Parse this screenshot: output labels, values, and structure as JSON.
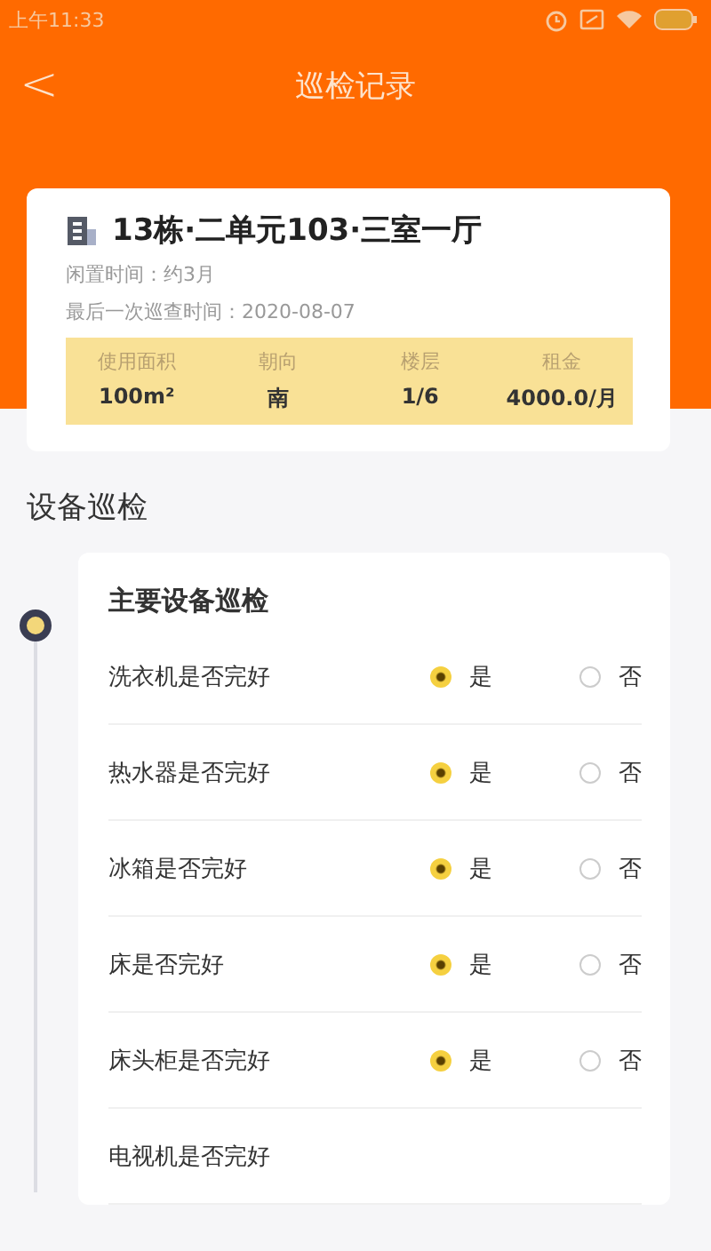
{
  "status_bar": {
    "time": "上午11:33"
  },
  "header": {
    "back": "<",
    "title": "巡检记录"
  },
  "property": {
    "title": "13栋·二单元103·三室一厅",
    "lines": [
      "闲置时间：约3月",
      "最后一次巡查时间：2020-08-07"
    ],
    "stats": [
      {
        "label": "使用面积",
        "value": "100m²"
      },
      {
        "label": "朝向",
        "value": "南"
      },
      {
        "label": "楼层",
        "value": "1/6"
      },
      {
        "label": "租金",
        "value": "4000.0/月"
      }
    ]
  },
  "section_title": "设备巡检",
  "group": {
    "title": "主要设备巡检",
    "items": [
      {
        "label": "洗衣机是否完好",
        "options": [
          {
            "label": "是",
            "selected": true
          },
          {
            "label": "否",
            "selected": false
          }
        ]
      },
      {
        "label": "热水器是否完好",
        "options": [
          {
            "label": "是",
            "selected": true
          },
          {
            "label": "否",
            "selected": false
          }
        ]
      },
      {
        "label": "冰箱是否完好",
        "options": [
          {
            "label": "是",
            "selected": true
          },
          {
            "label": "否",
            "selected": false
          }
        ]
      },
      {
        "label": "床是否完好",
        "options": [
          {
            "label": "是",
            "selected": true
          },
          {
            "label": "否",
            "selected": false
          }
        ]
      },
      {
        "label": "床头柜是否完好",
        "options": [
          {
            "label": "是",
            "selected": true
          },
          {
            "label": "否",
            "selected": false
          }
        ]
      },
      {
        "label": "电视机是否完好"
      }
    ]
  }
}
